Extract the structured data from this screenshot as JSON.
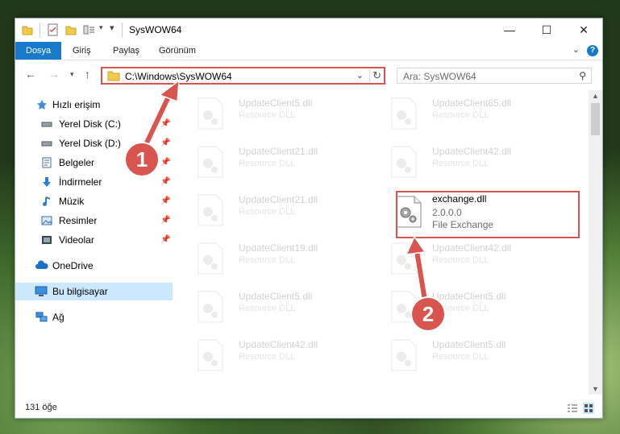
{
  "window": {
    "title": "SysWOW64"
  },
  "ribbon": {
    "tabs": [
      {
        "label": "Dosya",
        "active": true
      },
      {
        "label": "Giriş"
      },
      {
        "label": "Paylaş"
      },
      {
        "label": "Görünüm"
      }
    ]
  },
  "address": {
    "path": "C:\\Windows\\SysWOW64"
  },
  "search": {
    "placeholder": "Ara: SysWOW64"
  },
  "sidebar": {
    "items": [
      {
        "label": "Hızlı erişim"
      },
      {
        "label": "Yerel Disk (C:)"
      },
      {
        "label": "Yerel Disk (D:)"
      },
      {
        "label": "Belgeler"
      },
      {
        "label": "İndirmeler"
      },
      {
        "label": "Müzik"
      },
      {
        "label": "Resimler"
      },
      {
        "label": "Videolar"
      },
      {
        "label": "OneDrive"
      },
      {
        "label": "Bu bilgisayar"
      },
      {
        "label": "Ağ"
      }
    ]
  },
  "files": [
    {
      "name": "UpdateClient5.dll",
      "line1": "Resource DLL"
    },
    {
      "name": "UpdateClient65.dll",
      "line1": "Resource DLL"
    },
    {
      "name": "UpdateClient21.dll",
      "line1": "Resource DLL"
    },
    {
      "name": "UpdateClient42.dll",
      "line1": "Resource DLL"
    },
    {
      "name": "UpdateClient21.dll",
      "line1": "Resource DLL"
    },
    {
      "name": "exchange.dll",
      "line1": "2.0.0.0",
      "line2": "File Exchange"
    },
    {
      "name": "UpdateClient19.dll",
      "line1": "Resource DLL"
    },
    {
      "name": "UpdateClient42.dll",
      "line1": "Resource DLL"
    },
    {
      "name": "UpdateClient5.dll",
      "line1": "Resource DLL"
    },
    {
      "name": "UpdateClient5.dll",
      "line1": "Resource DLL"
    },
    {
      "name": "UpdateClient42.dll",
      "line1": "Resource DLL"
    },
    {
      "name": "UpdateClient5.dll",
      "line1": "Resource DLL"
    }
  ],
  "status": {
    "count": "131 öğe"
  },
  "callouts": {
    "one": "1",
    "two": "2"
  },
  "colors": {
    "accent": "#1979ca",
    "callout": "#d9534f",
    "selection": "#cce8ff"
  }
}
